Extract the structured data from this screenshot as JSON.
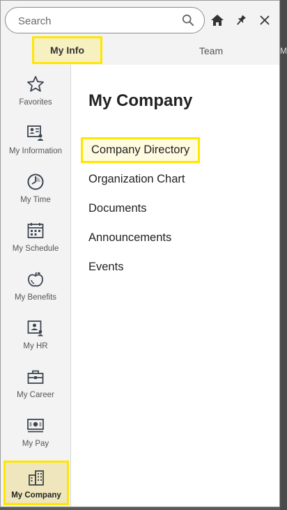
{
  "search": {
    "placeholder": "Search",
    "value": ""
  },
  "tabs": [
    {
      "label": "My Info",
      "active": true
    },
    {
      "label": "Team",
      "active": false
    }
  ],
  "sidebar": {
    "items": [
      {
        "label": "Favorites",
        "icon": "star-icon"
      },
      {
        "label": "My Information",
        "icon": "id-card-icon"
      },
      {
        "label": "My Time",
        "icon": "clock-icon"
      },
      {
        "label": "My Schedule",
        "icon": "calendar-icon"
      },
      {
        "label": "My Benefits",
        "icon": "apple-icon"
      },
      {
        "label": "My HR",
        "icon": "person-card-icon"
      },
      {
        "label": "My Career",
        "icon": "briefcase-icon"
      },
      {
        "label": "My Pay",
        "icon": "money-icon"
      },
      {
        "label": "My Company",
        "icon": "building-icon",
        "active": true
      }
    ]
  },
  "main": {
    "title": "My Company",
    "links": [
      {
        "label": "Company Directory",
        "highlighted": true
      },
      {
        "label": "Organization Chart"
      },
      {
        "label": "Documents"
      },
      {
        "label": "Announcements"
      },
      {
        "label": "Events"
      }
    ]
  },
  "colors": {
    "highlight": "#ffe600",
    "icon": "#3d4550",
    "panel": "#f3f3f3"
  }
}
